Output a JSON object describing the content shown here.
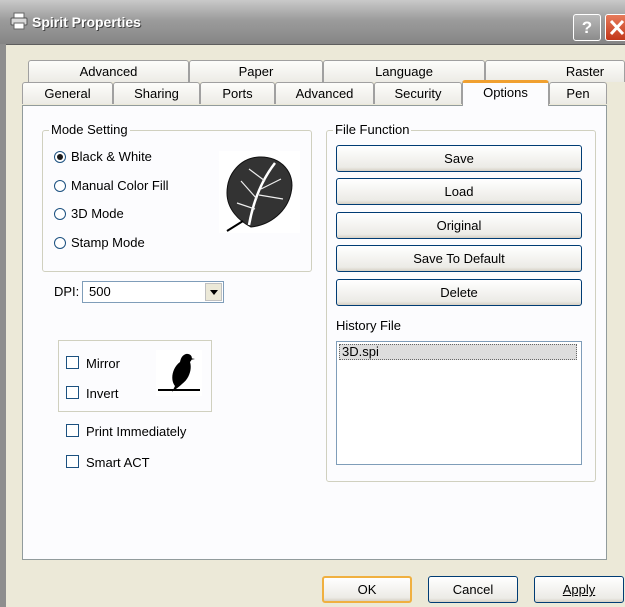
{
  "window": {
    "title": "Spirit Properties"
  },
  "title_buttons": {
    "help": "?"
  },
  "tabs_row1": [
    "Advanced",
    "Paper",
    "Language",
    "Raster"
  ],
  "tabs_row2": [
    "General",
    "Sharing",
    "Ports",
    "Advanced",
    "Security",
    "Options",
    "Pen"
  ],
  "active_tab": "Options",
  "mode_setting": {
    "label": "Mode Setting",
    "options": [
      "Black & White",
      "Manual Color Fill",
      "3D Mode",
      "Stamp Mode"
    ],
    "selected": "Black & White"
  },
  "dpi": {
    "label": "DPI:",
    "value": "500"
  },
  "file_function": {
    "label": "File Function",
    "buttons": [
      "Save",
      "Load",
      "Original",
      "Save To Default",
      "Delete"
    ]
  },
  "history_file": {
    "label": "History File",
    "items": [
      "3D.spi"
    ]
  },
  "mirror_group": {
    "mirror": {
      "label": "Mirror",
      "checked": false
    },
    "invert": {
      "label": "Invert",
      "checked": false
    }
  },
  "checkboxes": {
    "print_immediately": {
      "label": "Print Immediately",
      "checked": false
    },
    "smart_act": {
      "label": "Smart ACT",
      "checked": false
    }
  },
  "footer": {
    "ok": "OK",
    "cancel": "Cancel",
    "apply": "Apply"
  }
}
